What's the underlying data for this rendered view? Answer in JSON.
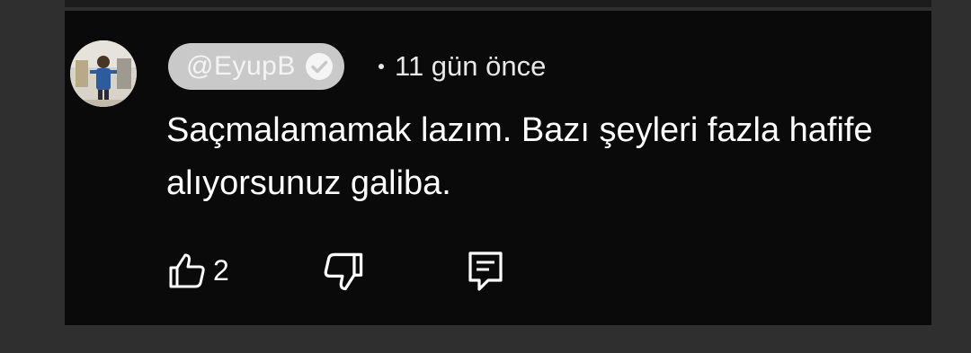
{
  "comment": {
    "handle": "@EyupB",
    "verified": true,
    "time_ago": "11 gün önce",
    "text": "Saçmalamamak lazım. Bazı şeyleri fazla hafife alıyorsunuz galiba.",
    "like_count": "2"
  },
  "icons": {
    "like": "thumbs-up-icon",
    "dislike": "thumbs-down-icon",
    "reply": "reply-comment-icon",
    "verified": "verified-check-icon"
  },
  "colors": {
    "background": "#0a0a0a",
    "text": "#ffffff",
    "handle_chip": "#c9c9c9"
  }
}
